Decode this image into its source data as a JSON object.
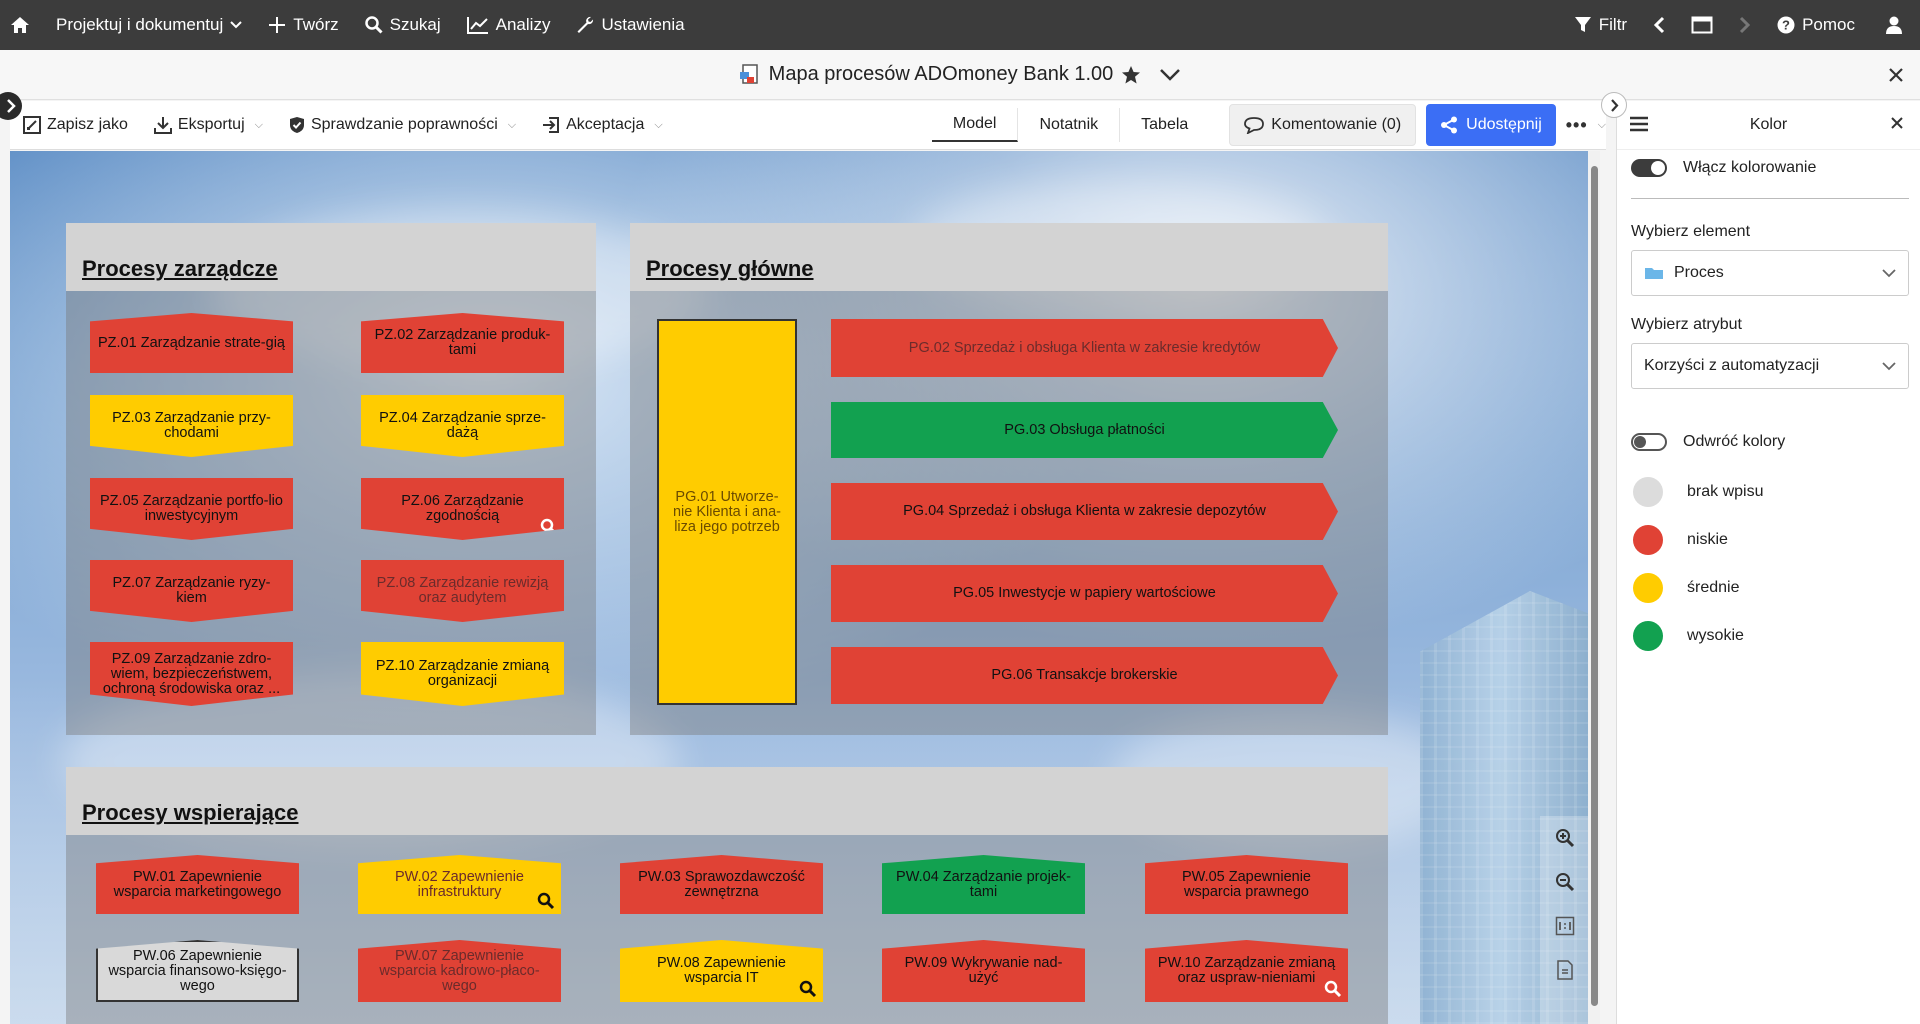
{
  "topnav": {
    "items": [
      {
        "label": "Projektuj i dokumentuj",
        "has_dropdown": true
      },
      {
        "label": "Twórz"
      },
      {
        "label": "Szukaj"
      },
      {
        "label": "Analizy"
      },
      {
        "label": "Ustawienia"
      }
    ],
    "filter_label": "Filtr",
    "help_label": "Pomoc"
  },
  "titlebar": {
    "title": "Mapa procesów ADOmoney Bank 1.00"
  },
  "toolbar": {
    "save_as": "Zapisz jako",
    "export": "Eksportuj",
    "validation": "Sprawdzanie poprawności",
    "acceptance": "Akceptacja",
    "tabs": [
      "Model",
      "Notatnik",
      "Tabela"
    ],
    "active_tab": "Model",
    "comment": "Komentowanie (0)",
    "share": "Udostępnij"
  },
  "groups": {
    "management": {
      "title": "Procesy zarządcze",
      "items": [
        {
          "label": "PZ.01 Zarządzanie strate-gią",
          "color": "red",
          "shape": "top"
        },
        {
          "label": "PZ.02 Zarządzanie produk-tami",
          "color": "red",
          "shape": "top"
        },
        {
          "label": "PZ.03 Zarządzanie przy-chodami",
          "color": "yellow",
          "shape": "bot"
        },
        {
          "label": "PZ.04 Zarządzanie sprze-dażą",
          "color": "yellow",
          "shape": "bot"
        },
        {
          "label": "PZ.05 Zarządzanie portfo-lio inwestycyjnym",
          "color": "red",
          "shape": "bot"
        },
        {
          "label": "PZ.06 Zarządzanie zgodnością",
          "color": "red",
          "shape": "bot",
          "magnifier": true
        },
        {
          "label": "PZ.07 Zarządzanie ryzy-kiem",
          "color": "red",
          "shape": "bot"
        },
        {
          "label": "PZ.08 Zarządzanie rewizją oraz audytem",
          "color": "red",
          "shape": "bot",
          "dim": true
        },
        {
          "label": "PZ.09 Zarządzanie zdro-wiem, bezpieczeństwem, ochroną środowiska oraz ...",
          "color": "red",
          "shape": "bot"
        },
        {
          "label": "PZ.10 Zarządzanie zmianą organizacji",
          "color": "yellow",
          "shape": "bot"
        }
      ]
    },
    "main": {
      "title": "Procesy główne",
      "tall_item": {
        "label": "PG.01 Utworze-nie Klienta i ana-liza jego potrzeb",
        "color": "yellow"
      },
      "items": [
        {
          "label": "PG.02 Sprzedaż i obsługa Klienta w zakresie kredytów",
          "color": "red",
          "dim": true
        },
        {
          "label": "PG.03 Obsługa płatności",
          "color": "green"
        },
        {
          "label": "PG.04 Sprzedaż i obsługa Klienta w zakresie depozytów",
          "color": "red"
        },
        {
          "label": "PG.05 Inwestycje w papiery wartościowe",
          "color": "red"
        },
        {
          "label": "PG.06 Transakcje brokerskie",
          "color": "red"
        }
      ]
    },
    "support": {
      "title": "Procesy wspierające",
      "items": [
        {
          "label": "PW.01 Zapewnienie wsparcia marketingowego",
          "color": "red",
          "shape": "top"
        },
        {
          "label": "PW.02 Zapewnienie infrastruktury",
          "color": "yellow",
          "shape": "top",
          "magnifier": true,
          "dim": true
        },
        {
          "label": "PW.03 Sprawozdawczość zewnętrzna",
          "color": "red",
          "shape": "top"
        },
        {
          "label": "PW.04 Zarządzanie projek-tami",
          "color": "green",
          "shape": "top"
        },
        {
          "label": "PW.05 Zapewnienie wsparcia prawnego",
          "color": "red",
          "shape": "top"
        },
        {
          "label": "PW.06 Zapewnienie wsparcia finansowo-księgo-wego",
          "color": "grey",
          "shape": "top"
        },
        {
          "label": "PW.07 Zapewnienie wsparcia kadrowo-płaco-wego",
          "color": "red",
          "shape": "top",
          "dim": true
        },
        {
          "label": "PW.08 Zapewnienie wsparcia IT",
          "color": "yellow",
          "shape": "top",
          "magnifier": true
        },
        {
          "label": "PW.09 Wykrywanie nad-użyć",
          "color": "red",
          "shape": "top"
        },
        {
          "label": "PW.10 Zarządzanie zmianą oraz usprаw-nieniami",
          "color": "red",
          "shape": "top",
          "magnifier": true
        }
      ]
    }
  },
  "rpanel": {
    "title": "Kolor",
    "enable_label": "Włącz kolorowanie",
    "element_label": "Wybierz element",
    "element_value": "Proces",
    "attribute_label": "Wybierz atrybut",
    "attribute_value": "Korzyści z automatyzacji",
    "invert_label": "Odwróć kolory",
    "legend": [
      {
        "label": "brak wpisu",
        "color": "#dcdcdc"
      },
      {
        "label": "niskie",
        "color": "#e04235"
      },
      {
        "label": "średnie",
        "color": "#ffcc00"
      },
      {
        "label": "wysokie",
        "color": "#12a150"
      }
    ]
  },
  "colors": {
    "accent": "#3b6ef5",
    "nav_bg": "#3c3c3c"
  }
}
